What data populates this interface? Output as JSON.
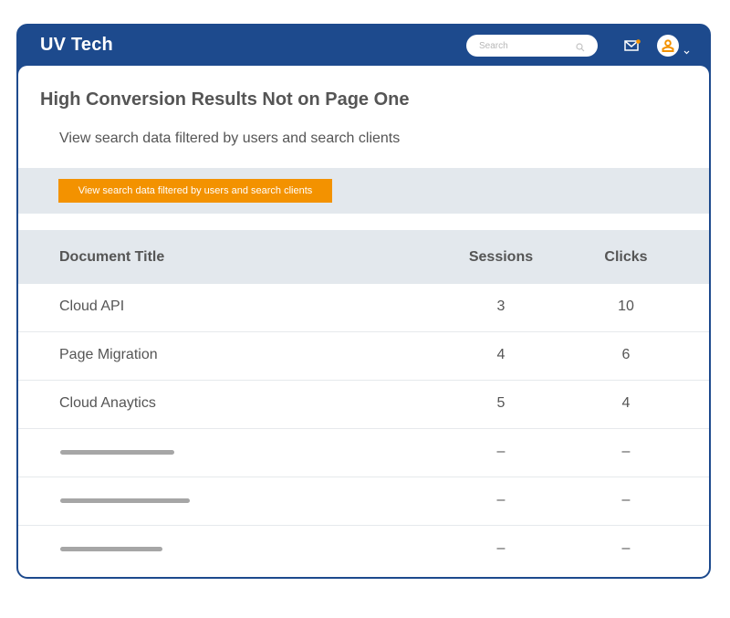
{
  "header": {
    "brand": "UV Tech",
    "search_placeholder": "Search",
    "search_value": ""
  },
  "colors": {
    "header_bg": "#1d4a8d",
    "accent_orange": "#f39200",
    "band_bg": "#e3e8ed",
    "text": "#555555"
  },
  "icons": {
    "search": "search-icon",
    "mail": "mail-icon",
    "avatar": "user-avatar-icon",
    "chevron": "chevron-down-icon"
  },
  "main": {
    "title": "High Conversion Results Not on Page One",
    "subtitle": "View search data filtered by users and search clients",
    "filter_button": "View search data filtered by users and search clients"
  },
  "table": {
    "columns": [
      "Document Title",
      "Sessions",
      "Clicks"
    ],
    "rows": [
      {
        "title": "Cloud API",
        "sessions": "3",
        "clicks": "10"
      },
      {
        "title": "Page Migration",
        "sessions": "4",
        "clicks": "6"
      },
      {
        "title": "Cloud  Anaytics",
        "sessions": "5",
        "clicks": "4"
      },
      {
        "title": null,
        "sessions": "–",
        "clicks": "–"
      },
      {
        "title": null,
        "sessions": "–",
        "clicks": "–"
      },
      {
        "title": null,
        "sessions": "–",
        "clicks": "–"
      }
    ]
  }
}
